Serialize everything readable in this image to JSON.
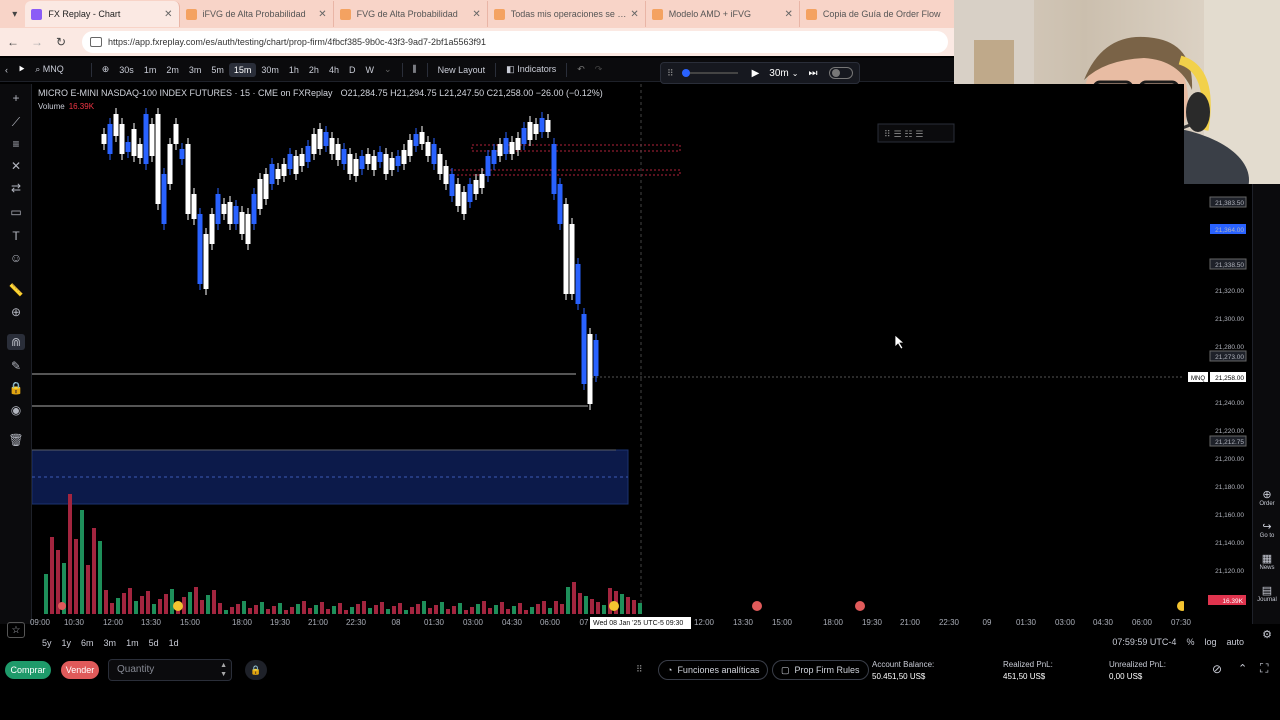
{
  "tabs": [
    {
      "label": "FX Replay - Chart",
      "active": true,
      "color": "#8b5cf6"
    },
    {
      "label": "iFVG de Alta Probabilidad",
      "active": false,
      "color": "#f4a261"
    },
    {
      "label": "FVG de Alta Probabilidad",
      "active": false,
      "color": "#f4a261"
    },
    {
      "label": "Todas mis operaciones se basan",
      "active": false,
      "color": "#f4a261"
    },
    {
      "label": "Modelo AMD + iFVG",
      "active": false,
      "color": "#f4a261"
    },
    {
      "label": "Copia de Guía de Order Flow",
      "active": false,
      "color": "#f4a261"
    }
  ],
  "address": {
    "url": "https://app.fxreplay.com/es/auth/testing/chart/prop-firm/4fbcf385-9b0c-43f3-9ad7-2bf1a5563f91"
  },
  "toolbar": {
    "symbol": "MNQ",
    "intervals": [
      "30s",
      "1m",
      "2m",
      "3m",
      "5m",
      "15m",
      "30m",
      "1h",
      "2h",
      "4h",
      "D",
      "W"
    ],
    "selected_interval": "15m",
    "new_layout": "New Layout",
    "indicators": "Indicators"
  },
  "replay": {
    "interval": "30m"
  },
  "legend": {
    "title": "MICRO E-MINI NASDAQ-100 INDEX FUTURES · 15 · CME on FXReplay",
    "ohlc": "O21,284.75 H21,294.75 L21,247.50 C21,258.00 −26.00 (−0.12%)",
    "volume_label": "Volume",
    "volume_value": "16.39K"
  },
  "price_axis": {
    "labels": [
      "21,383.50",
      "21,364.00",
      "21,338.50",
      "21,320.00",
      "21,300.00",
      "21,280.00",
      "21,273.00",
      "21,258.00",
      "21,240.00",
      "21,220.00",
      "21,212.75",
      "21,200.00",
      "21,180.00",
      "21,160.00",
      "21,140.00",
      "21,120.00"
    ],
    "current_symbol": "MNQ",
    "current_price": "21,258.00",
    "volume_badge": "16.39K"
  },
  "time_axis": {
    "labels": [
      "09:00",
      "10:30",
      "12:00",
      "13:30",
      "15:00",
      "18:00",
      "19:30",
      "21:00",
      "22:30",
      "08",
      "01:30",
      "03:00",
      "04:30",
      "06:00",
      "07",
      "12:00",
      "13:30",
      "15:00",
      "18:00",
      "19:30",
      "21:00",
      "22:30",
      "09",
      "01:30",
      "03:00",
      "04:30",
      "06:00",
      "07:30"
    ],
    "crosshair_time": "Wed 08 Jan '25 UTC-5   09:30"
  },
  "range": {
    "buttons": [
      "5y",
      "1y",
      "6m",
      "3m",
      "1m",
      "5d",
      "1d"
    ],
    "clock": "07:59:59 UTC-4",
    "percent": "%",
    "log": "log",
    "auto": "auto"
  },
  "right_panel": {
    "order": "Order",
    "goto": "Go to",
    "news": "News",
    "journal": "Journal"
  },
  "trade": {
    "buy": "Comprar",
    "sell": "Vender",
    "quantity_placeholder": "Quantity",
    "analytics": "Funciones analíticas",
    "prop_rules": "Prop Firm Rules",
    "account_balance_label": "Account Balance:",
    "account_balance": "50.451,50 US$",
    "realized_label": "Realized PnL:",
    "realized": "451,50 US$",
    "unrealized_label": "Unrealized PnL:",
    "unrealized": "0,00 US$"
  },
  "colors": {
    "up": "#2962ff",
    "down": "#ffffff",
    "vol_up": "#1e8f5a",
    "vol_down": "#a3253f",
    "zone": "#0c1a4a",
    "red_zone": "#b0223a"
  }
}
